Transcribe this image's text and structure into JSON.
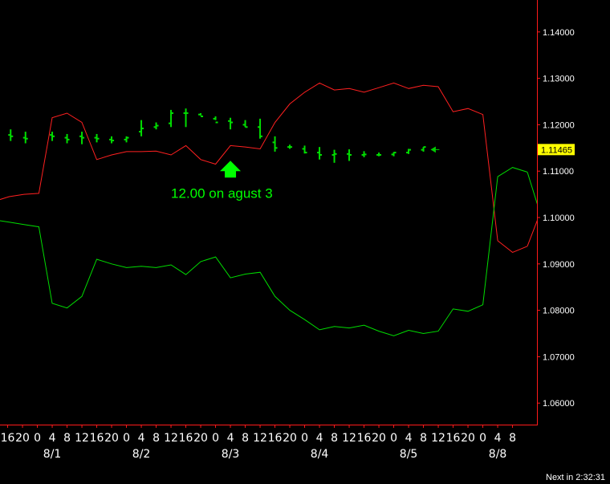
{
  "chart_data": {
    "type": "line",
    "title": "",
    "y_range": [
      1.055,
      1.149
    ],
    "y_ticks": [
      "1.14000",
      "1.13000",
      "1.12000",
      "1.11000",
      "1.10000",
      "1.09000",
      "1.08000",
      "1.07000",
      "1.06000"
    ],
    "y_tick_values": [
      1.14,
      1.13,
      1.12,
      1.11,
      1.1,
      1.09,
      1.08,
      1.07,
      1.06
    ],
    "x_hour_labels": [
      "12",
      "16",
      "20",
      "0",
      "4",
      "8",
      "12",
      "16",
      "20",
      "0",
      "4",
      "8",
      "12",
      "16",
      "20",
      "0",
      "4",
      "8",
      "12",
      "16",
      "20",
      "0",
      "4",
      "8",
      "12",
      "16",
      "20",
      "0",
      "4",
      "8",
      "12",
      "16",
      "20",
      "0",
      "4",
      "8"
    ],
    "x_hour_idx": [
      -3.7,
      -2.7,
      -1.7,
      -0.7,
      0.3,
      1.3,
      2.3,
      3.3,
      4.3,
      5.3,
      6.3,
      7.3,
      8.3,
      9.3,
      10.3,
      11.3,
      12.3,
      13.3,
      14.3,
      15.3,
      16.3,
      17.3,
      18.3,
      19.3,
      20.3,
      21.3,
      22.3,
      23.3,
      24.3,
      25.3,
      26.3,
      27.3,
      28.3,
      29.3,
      30.3,
      31.3
    ],
    "x_date_labels": [
      "8/1",
      "8/2",
      "8/3",
      "8/4",
      "8/5",
      "8/8"
    ],
    "x_date_idx": [
      0.3,
      6.3,
      12.3,
      18.3,
      24.3,
      30.3
    ],
    "current_price": "1.11465",
    "current_price_value": 1.11465,
    "annotation": {
      "text": "12.00 on agust 3",
      "idx": 12.3,
      "price": 1.1105
    },
    "upper_band": {
      "color": "#ff2020",
      "x": [
        -3.6,
        -2.6,
        -1.6,
        -0.6,
        0.3,
        1.3,
        2.3,
        3.3,
        4.3,
        5.3,
        6.3,
        7.3,
        8.3,
        9.3,
        10.3,
        11.3,
        12.3,
        13.3,
        14.3,
        15.3,
        16.3,
        17.3,
        18.3,
        19.3,
        20.3,
        21.3,
        22.3,
        23.3,
        24.3,
        25.3,
        26.3,
        27.3,
        28.3,
        29.3,
        30.3,
        31.3,
        32.3
      ],
      "values": [
        1.1035,
        1.1045,
        1.105,
        1.1052,
        1.1215,
        1.1225,
        1.1205,
        1.1125,
        1.1135,
        1.1142,
        1.1142,
        1.1143,
        1.1135,
        1.1155,
        1.1125,
        1.1115,
        1.1155,
        1.1152,
        1.1148,
        1.1205,
        1.1245,
        1.127,
        1.129,
        1.1275,
        1.1278,
        1.127,
        1.128,
        1.129,
        1.1278,
        1.1285,
        1.1282,
        1.1228,
        1.1235,
        1.1222,
        1.095,
        1.0925,
        1.0938
      ]
    },
    "lower_band": {
      "color": "#00dd00",
      "x": [
        -3.6,
        -2.6,
        -1.6,
        -0.6,
        0.3,
        1.3,
        2.3,
        3.3,
        4.3,
        5.3,
        6.3,
        7.3,
        8.3,
        9.3,
        10.3,
        11.3,
        12.3,
        13.3,
        14.3,
        15.3,
        16.3,
        17.3,
        18.3,
        19.3,
        20.3,
        21.3,
        22.3,
        23.3,
        24.3,
        25.3,
        26.3,
        27.3,
        28.3,
        29.3,
        30.3,
        31.3,
        32.3
      ],
      "values": [
        1.0995,
        1.099,
        1.0985,
        1.098,
        1.0815,
        1.0805,
        1.083,
        1.091,
        1.09,
        1.0892,
        1.0895,
        1.0892,
        1.0898,
        1.0877,
        1.0905,
        1.0915,
        1.087,
        1.0878,
        1.0882,
        1.083,
        1.08,
        1.078,
        1.0758,
        1.0765,
        1.0762,
        1.0768,
        1.0755,
        1.0745,
        1.0757,
        1.075,
        1.0755,
        1.0803,
        1.0798,
        1.0812,
        1.1088,
        1.1108,
        1.1098
      ]
    },
    "extra_segments": [
      {
        "color": "#ff2020",
        "x": [
          32.3,
          33.1
        ],
        "values": [
          1.0938,
          1.1005
        ]
      },
      {
        "color": "#00dd00",
        "x": [
          32.3,
          33.1
        ],
        "values": [
          1.1098,
          1.1015
        ]
      }
    ],
    "price_bars": {
      "color": "#00dd00",
      "x": [
        -3.5,
        -2.5,
        -1.5,
        0.3,
        1.3,
        2.3,
        3.3,
        4.3,
        5.3,
        6.3,
        7.3,
        8.3,
        9.3,
        10.3,
        11.3,
        12.3,
        13.3,
        14.3,
        15.3,
        16.3,
        17.3,
        18.3,
        19.3,
        20.3,
        21.3,
        22.3,
        23.3,
        24.3,
        25.3
      ],
      "high": [
        1.1195,
        1.119,
        1.1185,
        1.1185,
        1.118,
        1.1185,
        1.118,
        1.1175,
        1.1175,
        1.121,
        1.1205,
        1.1232,
        1.1235,
        1.1225,
        1.1218,
        1.1215,
        1.121,
        1.1213,
        1.1175,
        1.1157,
        1.1155,
        1.1152,
        1.1146,
        1.1147,
        1.1143,
        1.114,
        1.1141,
        1.1148,
        1.1152
      ],
      "low": [
        1.116,
        1.1165,
        1.116,
        1.1165,
        1.116,
        1.1158,
        1.1162,
        1.116,
        1.1162,
        1.1175,
        1.119,
        1.1195,
        1.1195,
        1.122,
        1.121,
        1.119,
        1.1195,
        1.117,
        1.1142,
        1.1148,
        1.1138,
        1.1125,
        1.1118,
        1.1122,
        1.113,
        1.1132,
        1.1132,
        1.1137,
        1.1142
      ],
      "open": [
        1.1182,
        1.1178,
        1.1172,
        1.1178,
        1.1172,
        1.1175,
        1.1172,
        1.1168,
        1.1168,
        1.1185,
        1.1195,
        1.1203,
        1.1225,
        1.1222,
        1.1213,
        1.1208,
        1.12,
        1.1195,
        1.1162,
        1.1152,
        1.1148,
        1.114,
        1.1135,
        1.1137,
        1.1135,
        1.1135,
        1.1136,
        1.114,
        1.1146
      ],
      "close": [
        1.118,
        1.1175,
        1.117,
        1.1175,
        1.1168,
        1.1172,
        1.117,
        1.1166,
        1.1172,
        1.1192,
        1.1198,
        1.1225,
        1.1225,
        1.1218,
        1.1205,
        1.1205,
        1.1195,
        1.1175,
        1.115,
        1.1152,
        1.114,
        1.1135,
        1.1137,
        1.1135,
        1.1136,
        1.1135,
        1.114,
        1.1146,
        1.1152
      ]
    }
  },
  "status_bar": {
    "next_in": "Next in 2:32:31"
  },
  "colors": {
    "axis": "#ff1a1a",
    "badge_bg": "#ffff00",
    "arrow": "#00ff00"
  }
}
